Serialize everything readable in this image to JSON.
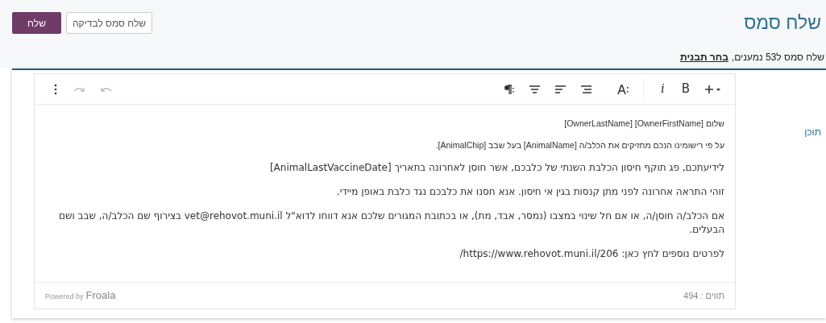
{
  "header": {
    "title": "שלח סמס",
    "buttons": [
      {
        "label": "שלח סמס לבדיקה",
        "kind": "secondary"
      },
      {
        "label": "שלח",
        "kind": "primary"
      }
    ]
  },
  "summary": {
    "text": "שלח סמס ל53 נמענים,",
    "link": "בחר תבנית"
  },
  "form": {
    "label": "תוכן",
    "editor": {
      "toolbar": [
        {
          "kind": "insert"
        },
        {
          "kind": "bold",
          "label": "B"
        },
        {
          "kind": "italic",
          "label": "i"
        },
        {
          "kind": "divider"
        },
        {
          "kind": "font-size"
        },
        {
          "kind": "align-right"
        },
        {
          "kind": "align-left"
        },
        {
          "kind": "align-center"
        },
        {
          "kind": "paragraph"
        }
      ],
      "history": [
        {
          "kind": "undo"
        },
        {
          "kind": "redo"
        },
        {
          "kind": "more"
        }
      ],
      "paragraphs": [
        {
          "kind": "small",
          "text": "שלום [OwnerFirstName] [OwnerLastName]"
        },
        {
          "kind": "small",
          "text": "על פי רישומינו הנכם מחזיקים את הכלב/ה [AnimalName] בעל שבב [AnimalChip]."
        },
        {
          "kind": "normal",
          "text": "לידיעתכם, פג תוקף חיסון הכלבת השנתי של כלבכם, אשר חוסן לאחרונה בתאריך [AnimalLastVaccineDate]"
        },
        {
          "kind": "normal",
          "text": "זוהי התראה אחרונה לפני מתן קנסות בגין אי חיסון. אנא חסנו את כלבכם נגד כלבת באופן מיידי."
        },
        {
          "kind": "normal",
          "text": "אם הכלב/ה חוסן/ה, או אם חל שינוי במצבו (נמסר, אבד, מת), או בכתובת המגורים שלכם אנא דווחו לדוא\"ל vet@rehovot.muni.il בצירוף שם הכלב/ה, שבב ושם הבעלים."
        },
        {
          "kind": "normal",
          "text": "לפרטים נוספים לחץ כאן: https://www.rehovot.muni.il/206/"
        }
      ],
      "footer": {
        "powered_by": "Powered by",
        "brand": "Froala",
        "count": "תווים : 494"
      }
    }
  }
}
